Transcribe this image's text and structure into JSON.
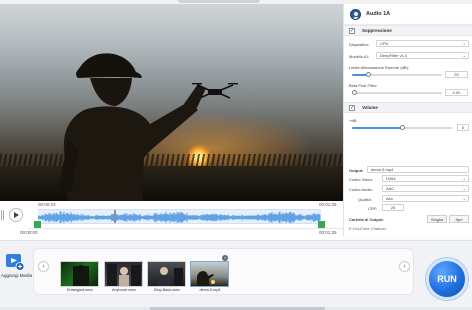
{
  "player": {
    "time_current": "00:00:23",
    "time_end": "00:01:25",
    "range_start": "00:00:00",
    "range_end": "00:01:25",
    "marker_position_pct": 27
  },
  "panel": {
    "title": "Audio 1A",
    "noise": {
      "section_label": "Soppressione",
      "device_label": "Dispositivo:",
      "device_value": "CPU",
      "model_label": "Modello AI:",
      "model_value": "DeepFilter v1.0",
      "limit_label": "Limite Attenuazione Rumore (dB):",
      "limit_value": "20",
      "limit_level_pct": 18,
      "postfilter_label": "Beta Post Filtro:",
      "postfilter_value": "0.00",
      "postfilter_level_pct": 0
    },
    "volume": {
      "section_label": "Volume",
      "db_label": "+dB:",
      "db_value": "0",
      "db_level_pct": 50
    },
    "output": {
      "output_label": "Output:",
      "output_value": "demo 5.mp4",
      "video_codec_label": "Codec Video:",
      "video_codec_value": "H264",
      "audio_codec_label": "Codec Audio:",
      "audio_codec_value": "AAC",
      "quality_label": "Qualità:",
      "quality_value": "Alto",
      "crf_label": "CRF:",
      "crf_value": "20",
      "folder_label": "Cartella di Output:",
      "browse_label": "Sfoglia",
      "open_label": "Apri",
      "folder_path": "E:\\YouTube Channel"
    }
  },
  "tray": {
    "add_media_label": "Aggiungi Media",
    "prev_icon": "chevron-left-icon",
    "next_icon": "chevron-right-icon",
    "items": [
      {
        "label": "Entangled.wmv",
        "selected": false
      },
      {
        "label": "Anymore.wmv",
        "selected": false
      },
      {
        "label": "Stop Back.wmv",
        "selected": false
      },
      {
        "label": "demo 5.mp4",
        "selected": true
      }
    ],
    "run_label": "RUN"
  },
  "colors": {
    "accent": "#1f6fe0",
    "handle_green": "#34a853",
    "waveform": "#3f8fe0"
  }
}
